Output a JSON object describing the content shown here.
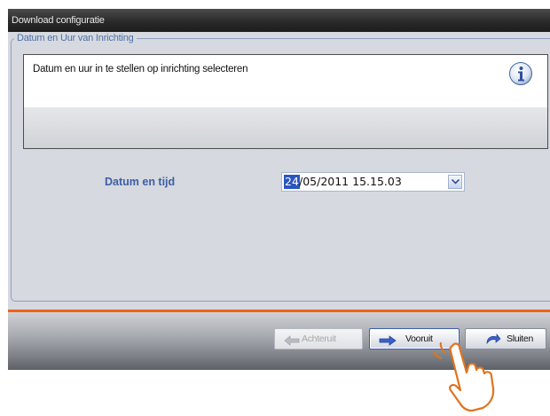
{
  "window": {
    "title": "Download configuratie"
  },
  "group": {
    "legend": "Datum en Uur van Inrichting"
  },
  "info": {
    "text": "Datum en uur in te stellen op inrichting selecteren",
    "icon": "info-icon"
  },
  "datetime": {
    "label": "Datum en tijd",
    "selected_part": "24",
    "rest": "/05/2011 15.15.03",
    "dropdown_icon": "chevron-down-icon"
  },
  "buttons": {
    "back": {
      "label": "Achteruit",
      "icon": "left-arrow-icon",
      "enabled": false
    },
    "next": {
      "label": "Vooruit",
      "icon": "right-arrow-icon",
      "enabled": true
    },
    "close": {
      "label": "Sluiten",
      "icon": "undo-arrow-icon",
      "enabled": true
    }
  },
  "colors": {
    "accent_orange": "#f0621a",
    "label_blue": "#3c5ea4",
    "selection_blue": "#2b56c0"
  }
}
